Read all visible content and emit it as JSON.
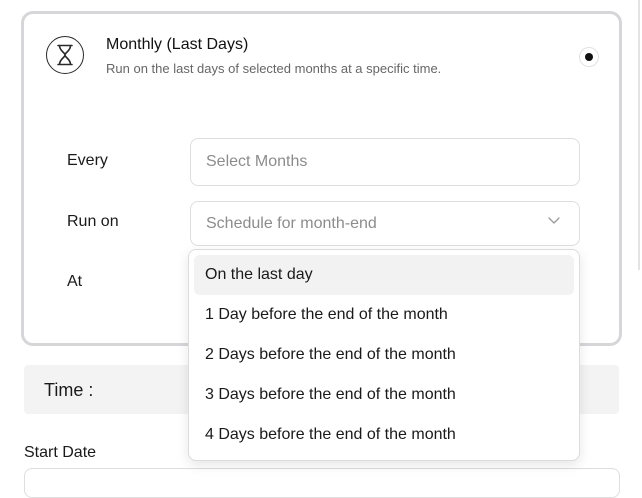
{
  "card": {
    "icon": "hourglass-icon",
    "title": "Monthly (Last Days)",
    "description": "Run on the last days of selected months at a specific time.",
    "selected": true
  },
  "form": {
    "every_label": "Every",
    "every_placeholder": "Select Months",
    "run_on_label": "Run on",
    "run_on_placeholder": "Schedule for month-end",
    "at_label": "At"
  },
  "dropdown": {
    "options": [
      "On the last day",
      "1 Day before the end of the month",
      "2 Days before the end of the month",
      "3 Days before the end of the month",
      "4 Days before the end of the month"
    ],
    "highlighted_index": 0
  },
  "time": {
    "label": "Time :"
  },
  "start_date": {
    "label": "Start Date"
  }
}
